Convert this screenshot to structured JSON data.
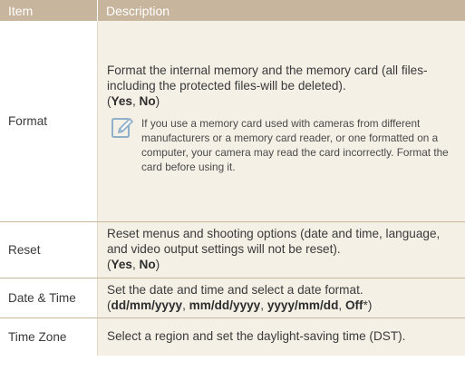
{
  "header": {
    "item": "Item",
    "description": "Description"
  },
  "rows": {
    "format": {
      "item": "Format",
      "desc_text": "Format the internal memory and the memory card (all files-including the protected files-will be deleted).",
      "option_open": "(",
      "option_1": "Yes",
      "option_sep": ", ",
      "option_2": "No",
      "option_close": ")",
      "note_icon": "pencil-note-icon",
      "note": "If you use a memory card used with cameras from different manufacturers or a memory card reader, or one formatted on a computer, your camera may read the card incorrectly. Format the card before using it."
    },
    "reset": {
      "item": "Reset",
      "desc_text": "Reset menus and shooting options (date and time, language, and video output settings will not be reset).",
      "option_open": "(",
      "option_1": "Yes",
      "option_sep": ", ",
      "option_2": "No",
      "option_close": ")"
    },
    "date_time": {
      "item": "Date & Time",
      "desc_text": "Set the date and time and select a date format.",
      "option_open": "(",
      "option_1": "dd/mm/yyyy",
      "sep_1": ", ",
      "option_2": "mm/dd/yyyy",
      "sep_2": ", ",
      "option_3": "yyyy/mm/dd",
      "sep_3": ", ",
      "option_4": "Off",
      "option_close": "*)"
    },
    "time_zone": {
      "item": "Time Zone",
      "desc_text": "Select a region and set the daylight-saving time (DST)."
    }
  },
  "colors": {
    "header_bg": "#c7b59d",
    "description_bg": "#f5f0e6",
    "divider": "#c7b59d",
    "text": "#3a3a3a"
  }
}
